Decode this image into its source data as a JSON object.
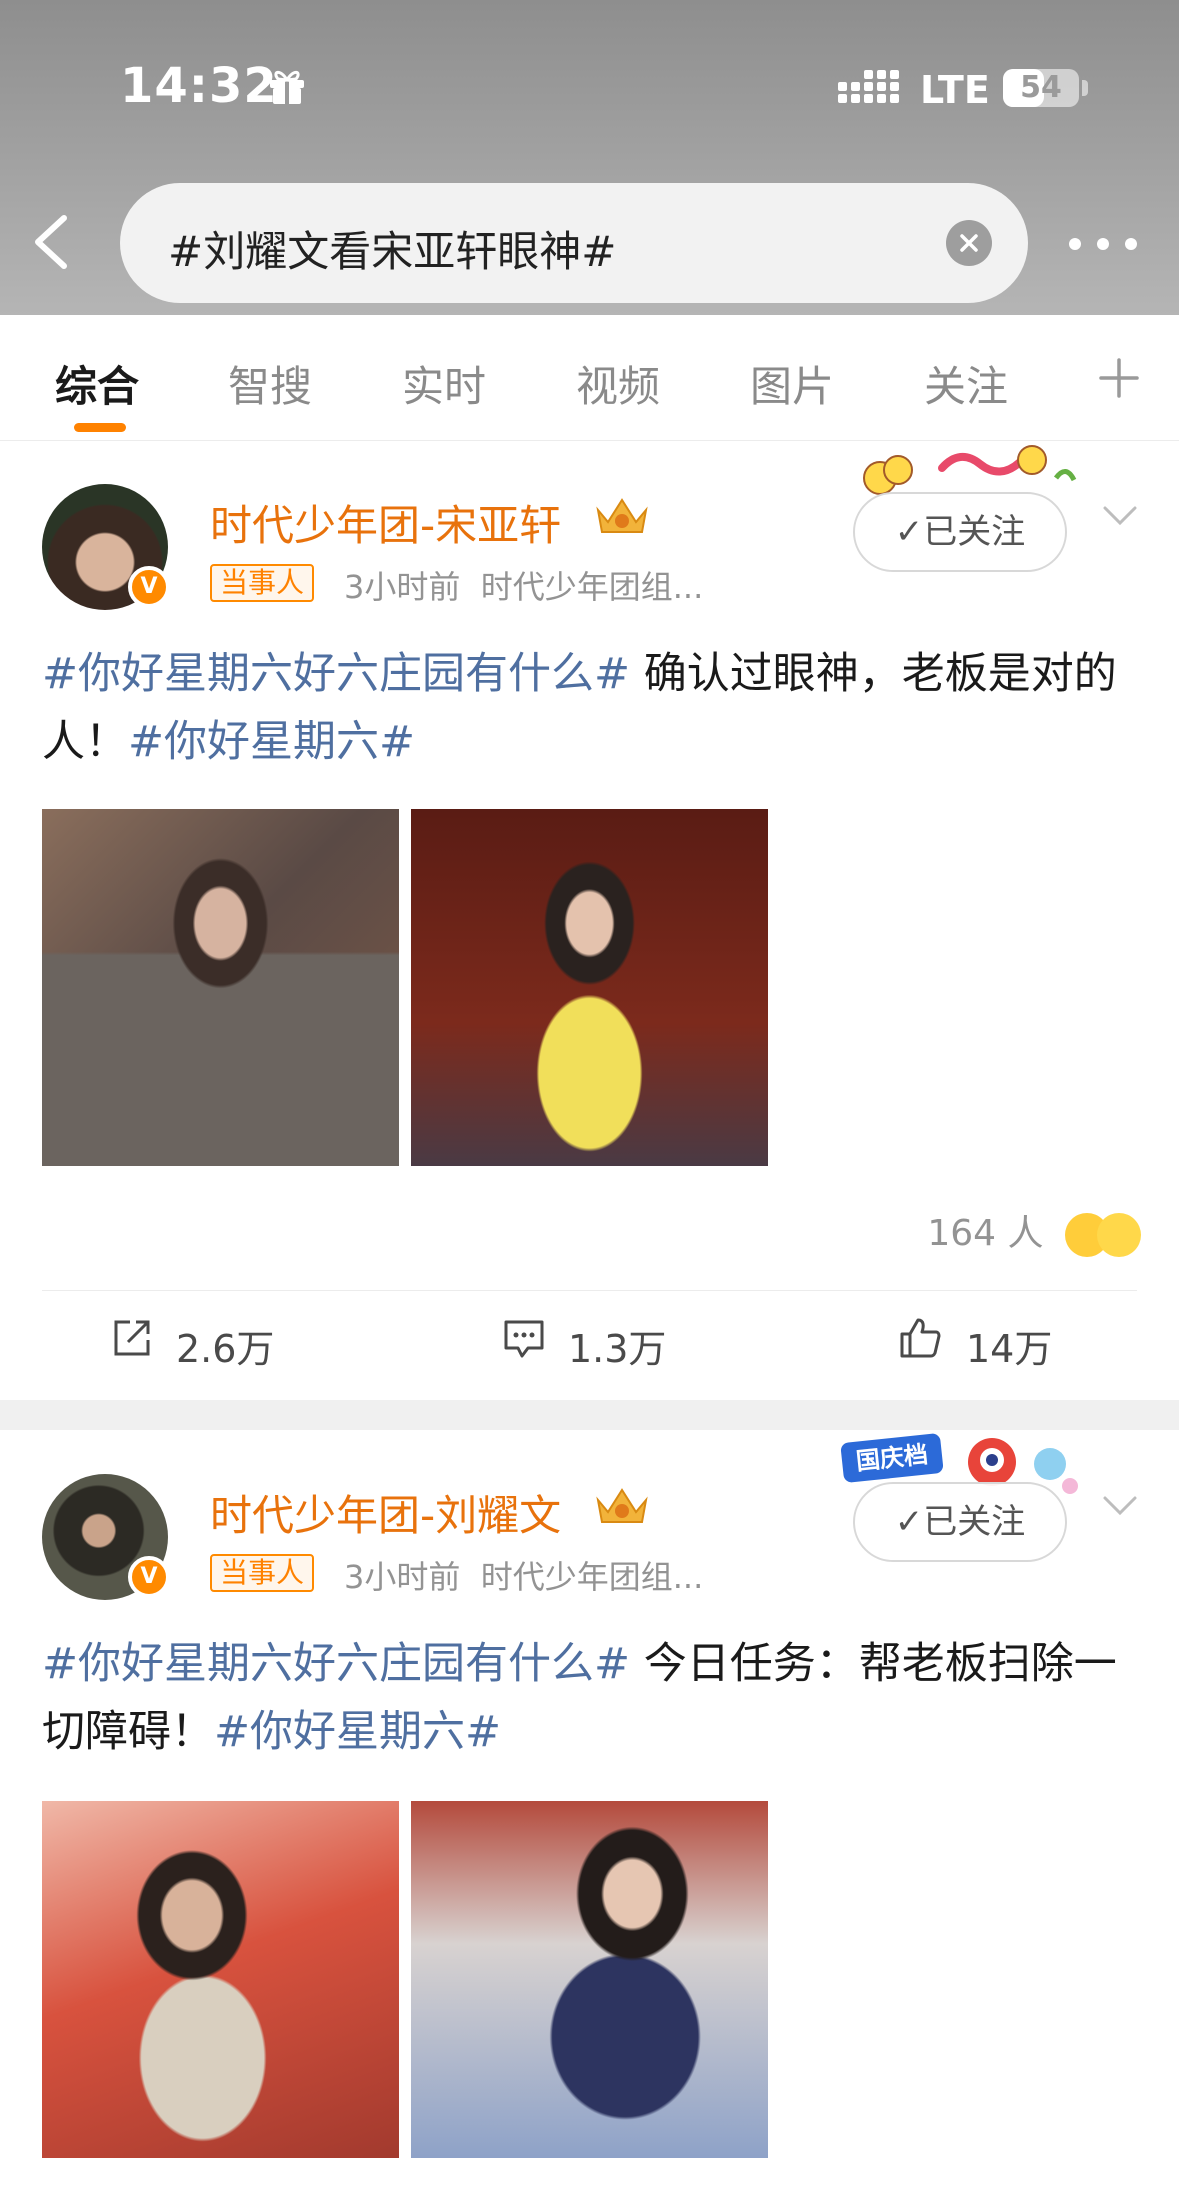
{
  "status_bar": {
    "time": "14:32",
    "network": "LTE",
    "battery": "54",
    "battery_level": 0.54
  },
  "search": {
    "query": "#刘耀文看宋亚轩眼神#"
  },
  "tabs": [
    "综合",
    "智搜",
    "实时",
    "视频",
    "图片",
    "关注"
  ],
  "accent_color": "#ff8200",
  "posts": [
    {
      "author": "时代少年团-宋亚轩",
      "tag": "当事人",
      "time": "3小时前",
      "source": "时代少年团组...",
      "follow_label": "已关注",
      "topic1": "#你好星期六好六庄园有什么#",
      "text": " 确认过眼神，老板是对的人！",
      "topic2": "#你好星期六#",
      "reactions_count": "164 人",
      "repost": "2.6万",
      "comments": "1.3万",
      "likes": "14万"
    },
    {
      "author": "时代少年团-刘耀文",
      "tag": "当事人",
      "time": "3小时前",
      "source": "时代少年团组...",
      "follow_label": "已关注",
      "badge_text": "国庆档",
      "topic1": "#你好星期六好六庄园有什么#",
      "text": " 今日任务：帮老板扫除一切障碍！",
      "topic2": "#你好星期六#"
    }
  ]
}
